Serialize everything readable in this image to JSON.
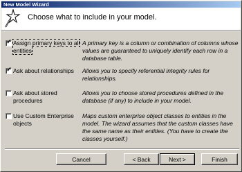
{
  "window": {
    "title": "New Model Wizard"
  },
  "header": {
    "title": "Choose what to include in your model.",
    "icon": "wizard-wand-icon"
  },
  "options": [
    {
      "label": "Assign primary keys to all entities",
      "checked": true,
      "description": "A primary key is a column or combination of columns whose values are guaranteed to uniquely identify each row in a database table."
    },
    {
      "label": "Ask about relationships",
      "checked": true,
      "description": "Allows you to specify referential integrity rules for relationships."
    },
    {
      "label": "Ask about stored procedures",
      "checked": false,
      "description": "Allows you to choose stored procedures defined in the database (if any) to include in your model."
    },
    {
      "label": "Use Custom Enterprise objects",
      "checked": false,
      "description": "Maps custom enterprise object classes to entities in the model. The wizard assumes that the custom classes have the same name as their entities. (You have to create the classes yourself.)"
    }
  ],
  "buttons": {
    "cancel": "Cancel",
    "back": "< Back",
    "next": "Next >",
    "finish": "Finish"
  },
  "check_glyph": "✓"
}
